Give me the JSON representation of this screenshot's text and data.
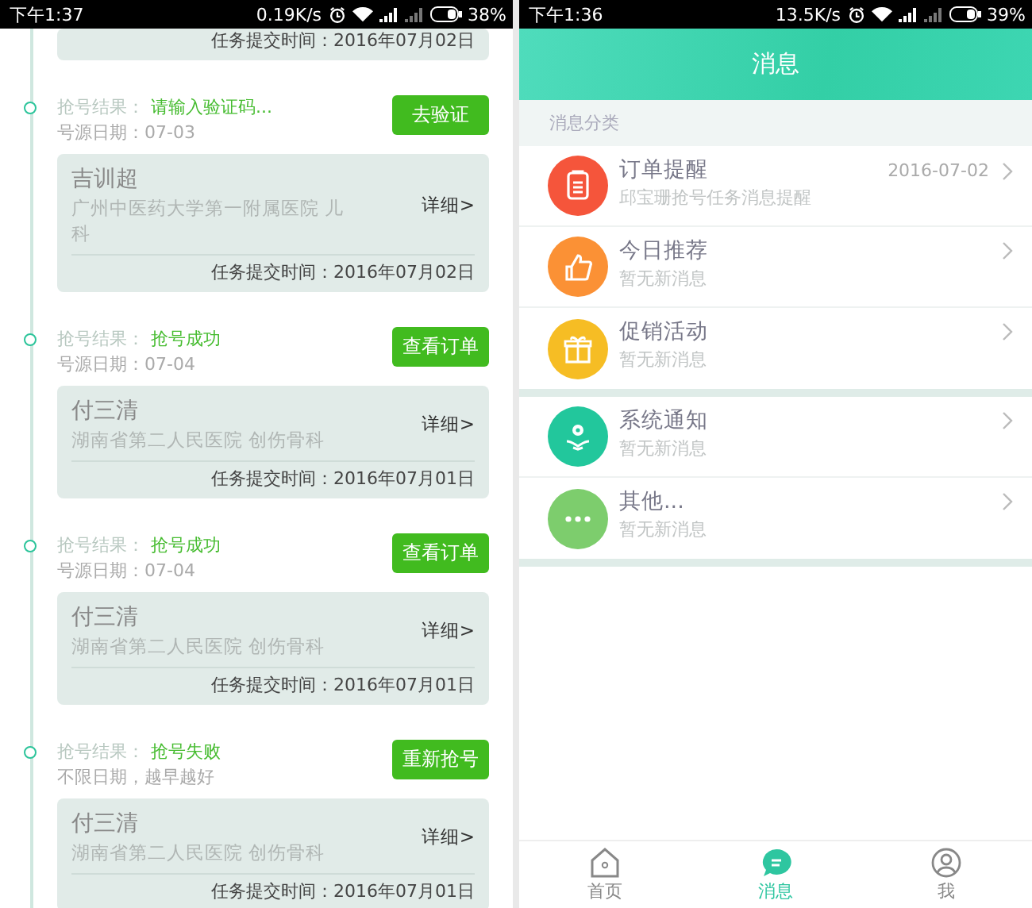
{
  "left_screen": {
    "status_bar": {
      "time": "下午1:37",
      "speed": "0.19K/s",
      "battery": "38%"
    },
    "partial_card": {
      "submit_time": "任务提交时间：2016年07月02日"
    },
    "entries": [
      {
        "result_label": "抢号结果：",
        "result": "请输入验证码...",
        "date": "号源日期：07-03",
        "button": "去验证",
        "name": "吉训超",
        "hospital": "广州中医药大学第一附属医院 儿科",
        "detail": "详细>",
        "submit_time": "任务提交时间：2016年07月02日"
      },
      {
        "result_label": "抢号结果：",
        "result": "抢号成功",
        "date": "号源日期：07-04",
        "button": "查看订单",
        "name": "付三清",
        "hospital": "湖南省第二人民医院 创伤骨科",
        "detail": "详细>",
        "submit_time": "任务提交时间：2016年07月01日"
      },
      {
        "result_label": "抢号结果：",
        "result": "抢号成功",
        "date": "号源日期：07-04",
        "button": "查看订单",
        "name": "付三清",
        "hospital": "湖南省第二人民医院 创伤骨科",
        "detail": "详细>",
        "submit_time": "任务提交时间：2016年07月01日"
      },
      {
        "result_label": "抢号结果：",
        "result": "抢号失败",
        "date": "不限日期，越早越好",
        "button": "重新抢号",
        "name": "付三清",
        "hospital": "湖南省第二人民医院 创伤骨科",
        "detail": "详细>",
        "submit_time": "任务提交时间：2016年07月01日"
      }
    ]
  },
  "right_screen": {
    "status_bar": {
      "time": "下午1:36",
      "speed": "13.5K/s",
      "battery": "39%"
    },
    "title": "消息",
    "section_label": "消息分类",
    "groups": [
      [
        {
          "kind": "order",
          "color": "#f5553b",
          "title": "订单提醒",
          "subtitle": "邱宝珊抢号任务消息提醒",
          "date": "2016-07-02"
        },
        {
          "kind": "recommend",
          "color": "#fb9135",
          "title": "今日推荐",
          "subtitle": "暂无新消息"
        },
        {
          "kind": "promotion",
          "color": "#f6bd24",
          "title": "促销活动",
          "subtitle": "暂无新消息"
        }
      ],
      [
        {
          "kind": "system",
          "color": "#22c79c",
          "title": "系统通知",
          "subtitle": "暂无新消息"
        },
        {
          "kind": "other",
          "color": "#7dcd6d",
          "title": "其他...",
          "subtitle": "暂无新消息"
        }
      ]
    ],
    "tabs": [
      {
        "kind": "home",
        "label": "首页",
        "selected": false
      },
      {
        "kind": "message",
        "label": "消息",
        "selected": true
      },
      {
        "kind": "me",
        "label": "我",
        "selected": false
      }
    ]
  }
}
